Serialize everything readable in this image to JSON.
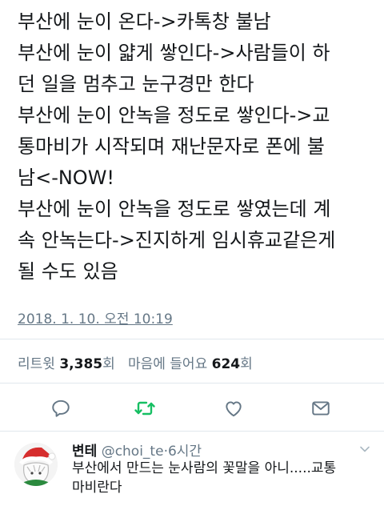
{
  "tweet": {
    "lines": [
      "부산에 눈이 온다->카톡창 불남",
      "부산에 눈이 얇게 쌓인다->사람들이 하",
      "던 일을 멈추고 눈구경만 한다",
      "부산에 눈이 안녹을 정도로 쌓인다->교",
      "통마비가 시작되며 재난문자로 폰에 불",
      "남<-NOW!",
      "부산에 눈이 안녹을 정도로 쌓였는데 계",
      "속 안녹는다->진지하게 임시휴교같은게",
      "될 수도 있음"
    ],
    "timestamp": "2018. 1. 10. 오전 10:19"
  },
  "stats": {
    "retweets_label": "리트윗",
    "retweets_count": "3,385",
    "retweets_unit": "회",
    "likes_label": "마음에 들어요",
    "likes_count": "624",
    "likes_unit": "회"
  },
  "actions": {
    "reply_icon": "reply-icon",
    "retweet_icon": "retweet-icon",
    "like_icon": "heart-icon",
    "dm_icon": "envelope-icon",
    "retweet_color": "#17bf63",
    "icon_color": "#657786"
  },
  "reply": {
    "name": "변테",
    "handle": "@choi_te",
    "separator": "·",
    "time": "6시간",
    "lines": [
      "부산에서 만드는 눈사람의 꽃말을 아니.....교통",
      "마비란다"
    ]
  }
}
